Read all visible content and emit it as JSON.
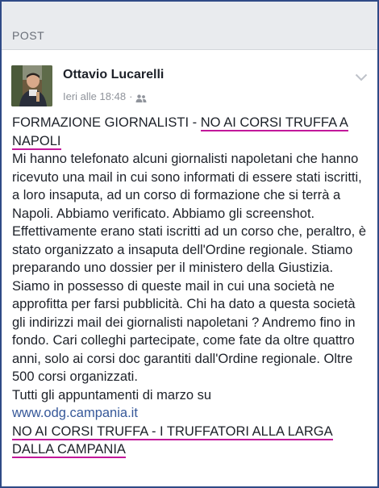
{
  "section": {
    "title": "POST"
  },
  "post": {
    "author": "Ottavio Lucarelli",
    "timestamp": "Ieri alle 18:48",
    "separator": "·",
    "privacy_icon": "friends-icon",
    "menu_icon": "chevron-down-icon",
    "headline_prefix": "FORMAZIONE GIORNALISTI - ",
    "headline_highlight_1": "NO AI CORSI TRUFFA A",
    "headline_highlight_2": "NAPOLI",
    "body": "Mi hanno telefonato alcuni giornalisti napoletani che hanno ricevuto una mail in cui sono informati di essere stati iscritti, a loro insaputa, ad un corso di formazione che si terrà a Napoli. Abbiamo verificato. Abbiamo gli screenshot.  Effettivamente erano stati iscritti ad un corso che, peraltro, è stato organizzato a insaputa dell'Ordine regionale. Stiamo preparando uno dossier per il ministero della Giustizia. Siamo in possesso di queste mail in cui una società ne approfitta per farsi pubblicità. Chi ha dato a questa società gli indirizzi mail dei giornalisti napoletani ? Andremo fino in fondo. Cari colleghi partecipate, come fate da oltre quattro anni, solo ai corsi doc garantiti dall'Ordine regionale. Oltre 500 corsi organizzati.",
    "appointments_text": "Tutti gli appuntamenti di marzo su",
    "link_text": "www.odg.campania.it",
    "footer_highlight_1": "NO AI CORSI TRUFFA - I TRUFFATORI ALLA LARGA",
    "footer_highlight_2": "DALLA CAMPANIA"
  },
  "colors": {
    "frame_border": "#2f4a86",
    "underline_accent": "#c2189a",
    "link": "#365899",
    "header_bg": "#e9ebee"
  }
}
